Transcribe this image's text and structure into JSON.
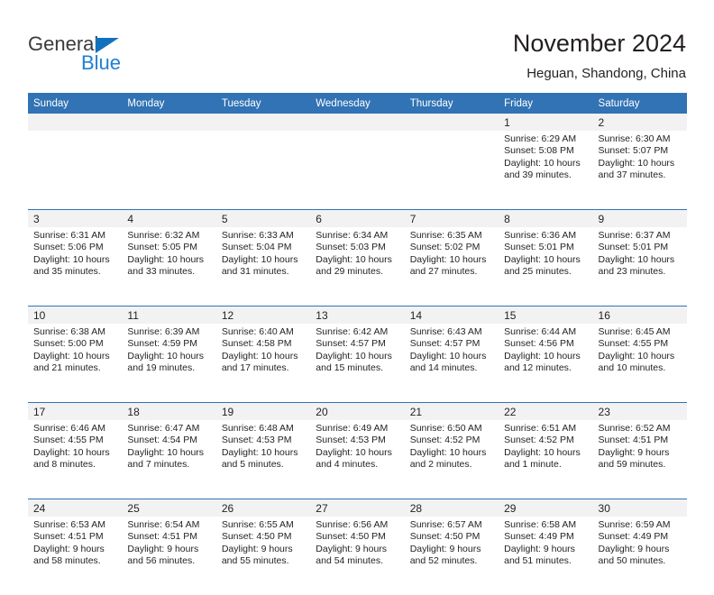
{
  "brand": {
    "name_part1": "General",
    "name_part2": "Blue",
    "triangle_color": "#1272bd",
    "blue_color": "#1f7fd4"
  },
  "header": {
    "title": "November 2024",
    "subtitle": "Heguan, Shandong, China"
  },
  "theme": {
    "header_blue": "#3173b4",
    "daynum_band": "#f2f2f2",
    "text": "#231f20"
  },
  "weekday_headers": [
    "Sunday",
    "Monday",
    "Tuesday",
    "Wednesday",
    "Thursday",
    "Friday",
    "Saturday"
  ],
  "weeks": [
    [
      {
        "day": "",
        "sunrise": "",
        "sunset": "",
        "daylight_1": "",
        "daylight_2": ""
      },
      {
        "day": "",
        "sunrise": "",
        "sunset": "",
        "daylight_1": "",
        "daylight_2": ""
      },
      {
        "day": "",
        "sunrise": "",
        "sunset": "",
        "daylight_1": "",
        "daylight_2": ""
      },
      {
        "day": "",
        "sunrise": "",
        "sunset": "",
        "daylight_1": "",
        "daylight_2": ""
      },
      {
        "day": "",
        "sunrise": "",
        "sunset": "",
        "daylight_1": "",
        "daylight_2": ""
      },
      {
        "day": "1",
        "sunrise": "Sunrise: 6:29 AM",
        "sunset": "Sunset: 5:08 PM",
        "daylight_1": "Daylight: 10 hours",
        "daylight_2": "and 39 minutes."
      },
      {
        "day": "2",
        "sunrise": "Sunrise: 6:30 AM",
        "sunset": "Sunset: 5:07 PM",
        "daylight_1": "Daylight: 10 hours",
        "daylight_2": "and 37 minutes."
      }
    ],
    [
      {
        "day": "3",
        "sunrise": "Sunrise: 6:31 AM",
        "sunset": "Sunset: 5:06 PM",
        "daylight_1": "Daylight: 10 hours",
        "daylight_2": "and 35 minutes."
      },
      {
        "day": "4",
        "sunrise": "Sunrise: 6:32 AM",
        "sunset": "Sunset: 5:05 PM",
        "daylight_1": "Daylight: 10 hours",
        "daylight_2": "and 33 minutes."
      },
      {
        "day": "5",
        "sunrise": "Sunrise: 6:33 AM",
        "sunset": "Sunset: 5:04 PM",
        "daylight_1": "Daylight: 10 hours",
        "daylight_2": "and 31 minutes."
      },
      {
        "day": "6",
        "sunrise": "Sunrise: 6:34 AM",
        "sunset": "Sunset: 5:03 PM",
        "daylight_1": "Daylight: 10 hours",
        "daylight_2": "and 29 minutes."
      },
      {
        "day": "7",
        "sunrise": "Sunrise: 6:35 AM",
        "sunset": "Sunset: 5:02 PM",
        "daylight_1": "Daylight: 10 hours",
        "daylight_2": "and 27 minutes."
      },
      {
        "day": "8",
        "sunrise": "Sunrise: 6:36 AM",
        "sunset": "Sunset: 5:01 PM",
        "daylight_1": "Daylight: 10 hours",
        "daylight_2": "and 25 minutes."
      },
      {
        "day": "9",
        "sunrise": "Sunrise: 6:37 AM",
        "sunset": "Sunset: 5:01 PM",
        "daylight_1": "Daylight: 10 hours",
        "daylight_2": "and 23 minutes."
      }
    ],
    [
      {
        "day": "10",
        "sunrise": "Sunrise: 6:38 AM",
        "sunset": "Sunset: 5:00 PM",
        "daylight_1": "Daylight: 10 hours",
        "daylight_2": "and 21 minutes."
      },
      {
        "day": "11",
        "sunrise": "Sunrise: 6:39 AM",
        "sunset": "Sunset: 4:59 PM",
        "daylight_1": "Daylight: 10 hours",
        "daylight_2": "and 19 minutes."
      },
      {
        "day": "12",
        "sunrise": "Sunrise: 6:40 AM",
        "sunset": "Sunset: 4:58 PM",
        "daylight_1": "Daylight: 10 hours",
        "daylight_2": "and 17 minutes."
      },
      {
        "day": "13",
        "sunrise": "Sunrise: 6:42 AM",
        "sunset": "Sunset: 4:57 PM",
        "daylight_1": "Daylight: 10 hours",
        "daylight_2": "and 15 minutes."
      },
      {
        "day": "14",
        "sunrise": "Sunrise: 6:43 AM",
        "sunset": "Sunset: 4:57 PM",
        "daylight_1": "Daylight: 10 hours",
        "daylight_2": "and 14 minutes."
      },
      {
        "day": "15",
        "sunrise": "Sunrise: 6:44 AM",
        "sunset": "Sunset: 4:56 PM",
        "daylight_1": "Daylight: 10 hours",
        "daylight_2": "and 12 minutes."
      },
      {
        "day": "16",
        "sunrise": "Sunrise: 6:45 AM",
        "sunset": "Sunset: 4:55 PM",
        "daylight_1": "Daylight: 10 hours",
        "daylight_2": "and 10 minutes."
      }
    ],
    [
      {
        "day": "17",
        "sunrise": "Sunrise: 6:46 AM",
        "sunset": "Sunset: 4:55 PM",
        "daylight_1": "Daylight: 10 hours",
        "daylight_2": "and 8 minutes."
      },
      {
        "day": "18",
        "sunrise": "Sunrise: 6:47 AM",
        "sunset": "Sunset: 4:54 PM",
        "daylight_1": "Daylight: 10 hours",
        "daylight_2": "and 7 minutes."
      },
      {
        "day": "19",
        "sunrise": "Sunrise: 6:48 AM",
        "sunset": "Sunset: 4:53 PM",
        "daylight_1": "Daylight: 10 hours",
        "daylight_2": "and 5 minutes."
      },
      {
        "day": "20",
        "sunrise": "Sunrise: 6:49 AM",
        "sunset": "Sunset: 4:53 PM",
        "daylight_1": "Daylight: 10 hours",
        "daylight_2": "and 4 minutes."
      },
      {
        "day": "21",
        "sunrise": "Sunrise: 6:50 AM",
        "sunset": "Sunset: 4:52 PM",
        "daylight_1": "Daylight: 10 hours",
        "daylight_2": "and 2 minutes."
      },
      {
        "day": "22",
        "sunrise": "Sunrise: 6:51 AM",
        "sunset": "Sunset: 4:52 PM",
        "daylight_1": "Daylight: 10 hours",
        "daylight_2": "and 1 minute."
      },
      {
        "day": "23",
        "sunrise": "Sunrise: 6:52 AM",
        "sunset": "Sunset: 4:51 PM",
        "daylight_1": "Daylight: 9 hours",
        "daylight_2": "and 59 minutes."
      }
    ],
    [
      {
        "day": "24",
        "sunrise": "Sunrise: 6:53 AM",
        "sunset": "Sunset: 4:51 PM",
        "daylight_1": "Daylight: 9 hours",
        "daylight_2": "and 58 minutes."
      },
      {
        "day": "25",
        "sunrise": "Sunrise: 6:54 AM",
        "sunset": "Sunset: 4:51 PM",
        "daylight_1": "Daylight: 9 hours",
        "daylight_2": "and 56 minutes."
      },
      {
        "day": "26",
        "sunrise": "Sunrise: 6:55 AM",
        "sunset": "Sunset: 4:50 PM",
        "daylight_1": "Daylight: 9 hours",
        "daylight_2": "and 55 minutes."
      },
      {
        "day": "27",
        "sunrise": "Sunrise: 6:56 AM",
        "sunset": "Sunset: 4:50 PM",
        "daylight_1": "Daylight: 9 hours",
        "daylight_2": "and 54 minutes."
      },
      {
        "day": "28",
        "sunrise": "Sunrise: 6:57 AM",
        "sunset": "Sunset: 4:50 PM",
        "daylight_1": "Daylight: 9 hours",
        "daylight_2": "and 52 minutes."
      },
      {
        "day": "29",
        "sunrise": "Sunrise: 6:58 AM",
        "sunset": "Sunset: 4:49 PM",
        "daylight_1": "Daylight: 9 hours",
        "daylight_2": "and 51 minutes."
      },
      {
        "day": "30",
        "sunrise": "Sunrise: 6:59 AM",
        "sunset": "Sunset: 4:49 PM",
        "daylight_1": "Daylight: 9 hours",
        "daylight_2": "and 50 minutes."
      }
    ]
  ]
}
